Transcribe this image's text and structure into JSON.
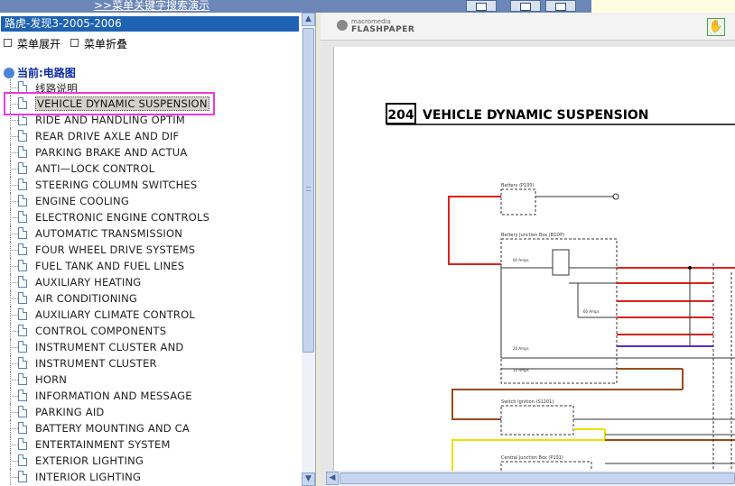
{
  "top": {
    "link": ">>菜单关键字搜索演示"
  },
  "left_panel": {
    "title": "路虎-发现3-2005-2006",
    "expand_label": "菜单展开",
    "collapse_label": "菜单折叠",
    "root_label": "当前:电路图",
    "items": [
      {
        "label": "线路说明"
      },
      {
        "label": "VEHICLE DYNAMIC SUSPENSION"
      },
      {
        "label": "RIDE AND HANDLING OPTIM"
      },
      {
        "label": "REAR DRIVE AXLE AND DIF"
      },
      {
        "label": "PARKING BRAKE AND ACTUA"
      },
      {
        "label": "ANTI—LOCK CONTROL"
      },
      {
        "label": "STEERING COLUMN SWITCHES"
      },
      {
        "label": "ENGINE COOLING"
      },
      {
        "label": "ELECTRONIC ENGINE CONTROLS"
      },
      {
        "label": "AUTOMATIC TRANSMISSION"
      },
      {
        "label": "FOUR WHEEL DRIVE SYSTEMS"
      },
      {
        "label": "FUEL TANK AND FUEL LINES"
      },
      {
        "label": "AUXILIARY HEATING"
      },
      {
        "label": "AIR CONDITIONING"
      },
      {
        "label": "AUXILIARY CLIMATE CONTROL"
      },
      {
        "label": "CONTROL COMPONENTS"
      },
      {
        "label": "INSTRUMENT CLUSTER AND"
      },
      {
        "label": "INSTRUMENT CLUSTER"
      },
      {
        "label": "HORN"
      },
      {
        "label": "INFORMATION AND MESSAGE"
      },
      {
        "label": "PARKING AID"
      },
      {
        "label": "BATTERY MOUNTING AND CA"
      },
      {
        "label": "ENTERTAINMENT SYSTEM"
      },
      {
        "label": "EXTERIOR LIGHTING"
      },
      {
        "label": "INTERIOR LIGHTING"
      }
    ],
    "selected_index": 1
  },
  "viewer": {
    "brand_small": "macromedia",
    "brand_big": "FLASHPAPER",
    "page_number": "204",
    "page_title": "VEHICLE DYNAMIC SUSPENSION",
    "labels": {
      "battery": "Battery (P100)",
      "bjb": "Battery Junction Box (B1DP)",
      "switch": "Switch Ignition (S1201)",
      "cjb": "Central Junction Box (P101)",
      "fuse1": "60 Amps",
      "fuse2": "20 Amps",
      "fuse3": "60 Amps",
      "fuse4": "10 Amps"
    },
    "colors": {
      "red": "#e0201c",
      "brown": "#9a4a1c",
      "yellow": "#efe000",
      "purple": "#5a2cc8",
      "black": "#111111"
    }
  }
}
